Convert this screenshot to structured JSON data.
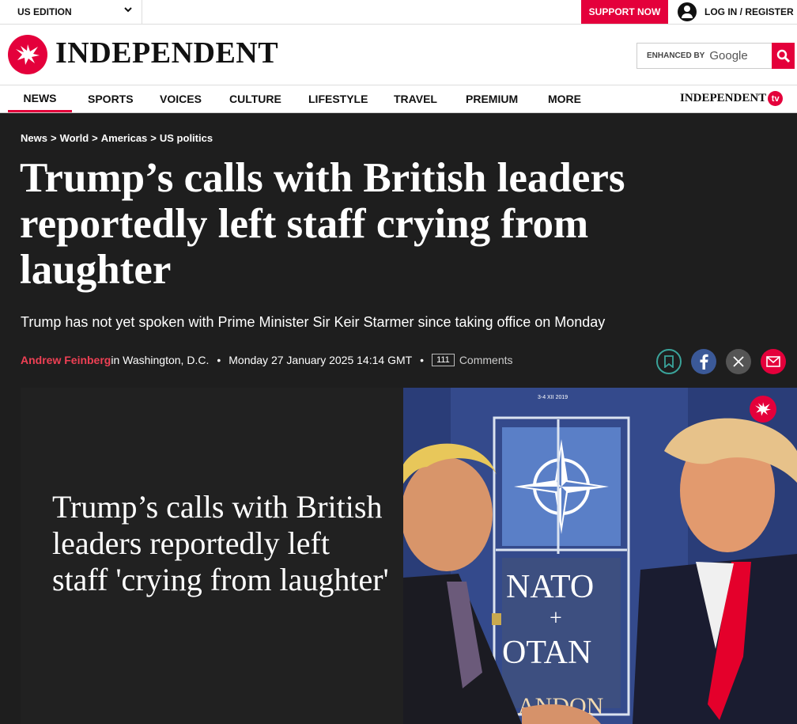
{
  "topbar": {
    "edition": "US EDITION",
    "support": "SUPPORT NOW",
    "login": "LOG IN / REGISTER"
  },
  "masthead": {
    "logo_text": "INDEPENDENT",
    "search_enhanced": "ENHANCED BY",
    "search_brand": "Google"
  },
  "nav": {
    "items": [
      "NEWS",
      "SPORTS",
      "VOICES",
      "CULTURE",
      "LIFESTYLE",
      "TRAVEL",
      "PREMIUM",
      "MORE"
    ],
    "tv_text": "INDEPENDENT",
    "tv_badge": "tv"
  },
  "article": {
    "breadcrumbs": [
      "News",
      "World",
      "Americas",
      "US politics"
    ],
    "headline": "Trump’s calls with British leaders reportedly left staff crying from laughter",
    "standfirst": "Trump has not yet spoken with Prime Minister Sir Keir Starmer since taking office on Monday",
    "author": "Andrew Feinberg",
    "location": " in Washington, D.C.",
    "date": "Monday 27 January 2025 14:14 GMT",
    "comment_count": "111",
    "comments_label": "Comments"
  },
  "media": {
    "video_title": "Trump’s calls with British leaders reportedly left staff 'crying from laughter'",
    "nato_top": "NATO",
    "nato_plus": "+",
    "nato_bottom": "OTAN",
    "nato_strip": "3-4 XII 2019",
    "nato_lower": "ANDON"
  },
  "colors": {
    "brand_red": "#e4003b",
    "background": "#1e1e1e",
    "author_red": "#ee4054"
  }
}
